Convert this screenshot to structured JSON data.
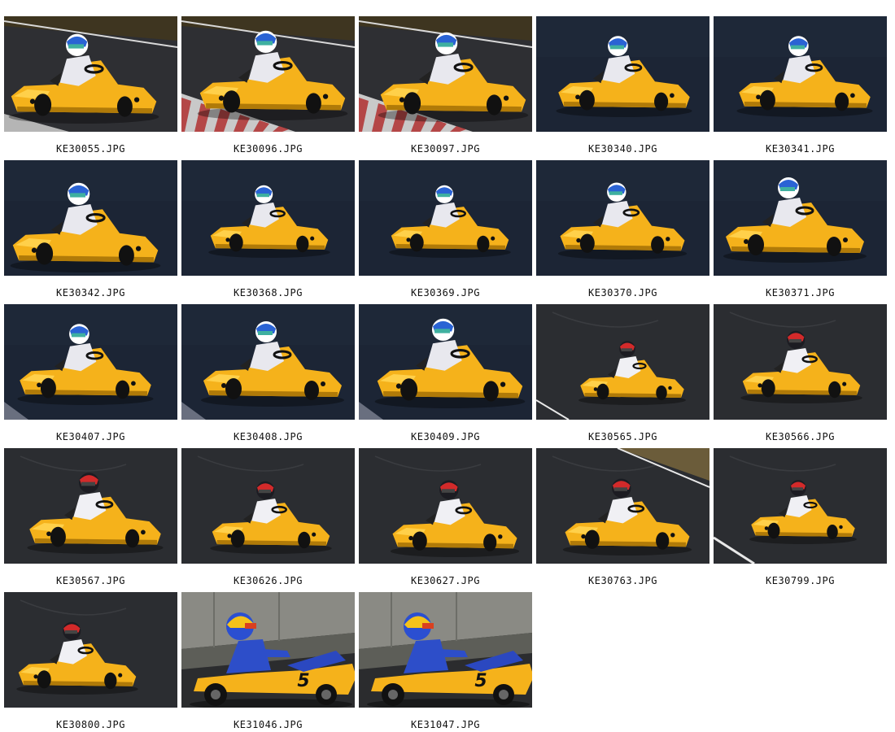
{
  "thumbnails": [
    {
      "filename": "KE30055.JPG",
      "scene": "track-stripe-dusk",
      "helmet": "white-blue"
    },
    {
      "filename": "KE30096.JPG",
      "scene": "track-curb",
      "helmet": "white-blue"
    },
    {
      "filename": "KE30097.JPG",
      "scene": "track-curb",
      "helmet": "white-blue"
    },
    {
      "filename": "KE30340.JPG",
      "scene": "dark-blue",
      "helmet": "white-blue"
    },
    {
      "filename": "KE30341.JPG",
      "scene": "dark-blue",
      "helmet": "white-blue"
    },
    {
      "filename": "KE30342.JPG",
      "scene": "dark-blue",
      "helmet": "white-blue"
    },
    {
      "filename": "KE30368.JPG",
      "scene": "dark-blue",
      "helmet": "white-blue"
    },
    {
      "filename": "KE30369.JPG",
      "scene": "dark-blue",
      "helmet": "white-blue"
    },
    {
      "filename": "KE30370.JPG",
      "scene": "dark-blue",
      "helmet": "white-blue"
    },
    {
      "filename": "KE30371.JPG",
      "scene": "dark-blue",
      "helmet": "white-blue"
    },
    {
      "filename": "KE30407.JPG",
      "scene": "dark-blue-curb",
      "helmet": "white-blue"
    },
    {
      "filename": "KE30408.JPG",
      "scene": "dark-blue-curb",
      "helmet": "white-blue"
    },
    {
      "filename": "KE30409.JPG",
      "scene": "dark-blue-curb",
      "helmet": "white-blue"
    },
    {
      "filename": "KE30565.JPG",
      "scene": "grey-asphalt",
      "helmet": "red-black"
    },
    {
      "filename": "KE30566.JPG",
      "scene": "grey-asphalt",
      "helmet": "red-black"
    },
    {
      "filename": "KE30567.JPG",
      "scene": "grey-asphalt",
      "helmet": "red-black"
    },
    {
      "filename": "KE30626.JPG",
      "scene": "grey-asphalt",
      "helmet": "red-black"
    },
    {
      "filename": "KE30627.JPG",
      "scene": "grey-asphalt",
      "helmet": "red-black"
    },
    {
      "filename": "KE30763.JPG",
      "scene": "grey-asphalt-edge",
      "helmet": "red-black"
    },
    {
      "filename": "KE30799.JPG",
      "scene": "grey-asphalt-line",
      "helmet": "red-black"
    },
    {
      "filename": "KE30800.JPG",
      "scene": "grey-asphalt",
      "helmet": "red-black"
    },
    {
      "filename": "KE31046.JPG",
      "scene": "side-wall",
      "helmet": "blue-yellow-red"
    },
    {
      "filename": "KE31047.JPG",
      "scene": "side-wall",
      "helmet": "blue-yellow-red"
    }
  ],
  "kart_number": "5",
  "colors": {
    "kart_yellow": "#f5b21b",
    "kart_shadow": "#b07a08",
    "track_dark_blue": "#1c2535",
    "track_grey": "#2b2d31",
    "caption_text": "#111111"
  }
}
